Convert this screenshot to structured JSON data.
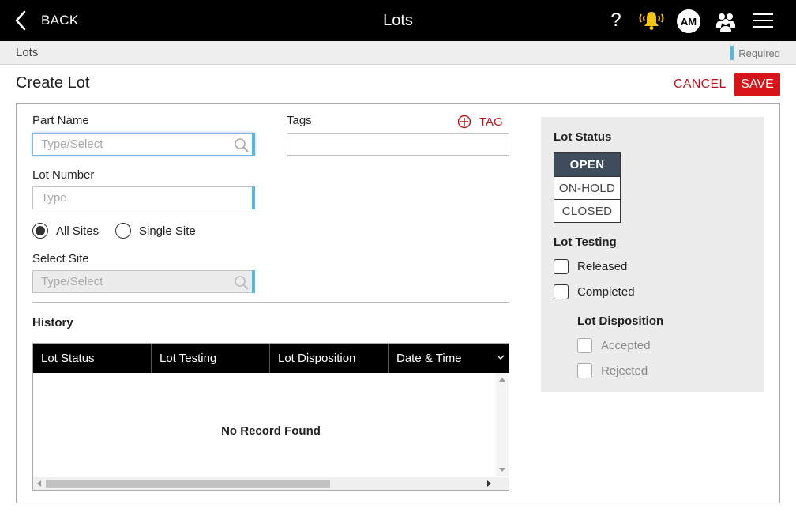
{
  "header": {
    "back_label": "BACK",
    "title": "Lots",
    "help_label": "?",
    "avatar_initials": "AM"
  },
  "breadcrumb": {
    "label": "Lots",
    "required_label": "Required"
  },
  "page": {
    "title": "Create Lot",
    "cancel_label": "CANCEL",
    "save_label": "SAVE"
  },
  "form": {
    "part_name": {
      "label": "Part Name",
      "placeholder": "Type/Select",
      "value": ""
    },
    "tags": {
      "label": "Tags",
      "add_label": "TAG",
      "value": ""
    },
    "lot_number": {
      "label": "Lot Number",
      "placeholder": "Type",
      "value": ""
    },
    "site_scope": {
      "options": [
        "All Sites",
        "Single Site"
      ],
      "selected": "All Sites"
    },
    "select_site": {
      "label": "Select Site",
      "placeholder": "Type/Select",
      "value": ""
    }
  },
  "history": {
    "title": "History",
    "columns": [
      "Lot Status",
      "Lot Testing",
      "Lot Disposition",
      "Date & Time"
    ],
    "rows": [],
    "empty_text": "No Record Found"
  },
  "side": {
    "lot_status": {
      "title": "Lot Status",
      "options": [
        "OPEN",
        "ON-HOLD",
        "CLOSED"
      ],
      "selected": "OPEN"
    },
    "lot_testing": {
      "title": "Lot Testing",
      "options": [
        "Released",
        "Completed"
      ]
    },
    "lot_disposition": {
      "title": "Lot Disposition",
      "options": [
        "Accepted",
        "Rejected"
      ]
    }
  },
  "colors": {
    "accent_red": "#d7141a",
    "required_blue": "#55b8e0",
    "status_active": "#3f4d5c",
    "bell_yellow": "#f5c518"
  }
}
